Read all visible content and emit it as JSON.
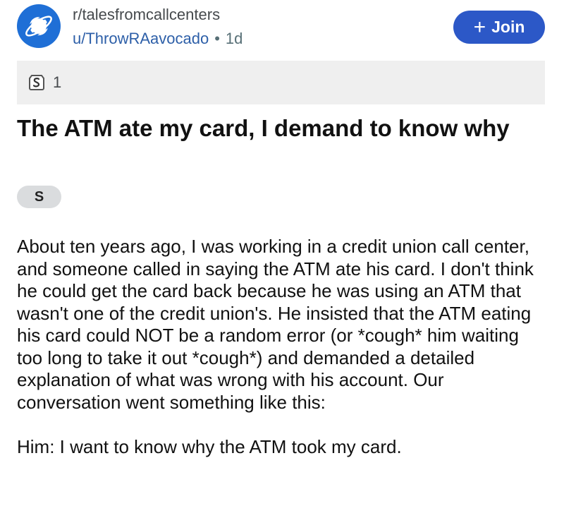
{
  "post": {
    "subreddit": "r/talesfromcallcenters",
    "author": "u/ThrowRAavocado",
    "separator": "•",
    "age": "1d",
    "join_label": "Join",
    "award_count": "1",
    "title": "The ATM ate my card, I demand to know why",
    "flair": "S",
    "paragraphs": [
      "About ten years ago, I was working in a credit union call center, and someone called in saying the ATM ate his card. I don't think he could get the card back because he was using an ATM that wasn't one of the credit union's. He insisted that the ATM eating his card could NOT be a random error (or *cough* him waiting too long to take it out *cough*) and demanded a detailed explanation of what was wrong with his account. Our conversation went something like this:",
      "Him: I want to know why the ATM took my card."
    ]
  },
  "icons": {
    "avatar": "planet-icon",
    "award": "award-icon",
    "join": "plus-icon"
  },
  "colors": {
    "avatar_bg": "#1f6fd6",
    "join_bg": "#2c58c7",
    "author_link": "#2d5fa8",
    "award_bar_bg": "#efefef",
    "flair_bg": "#dadcde"
  }
}
